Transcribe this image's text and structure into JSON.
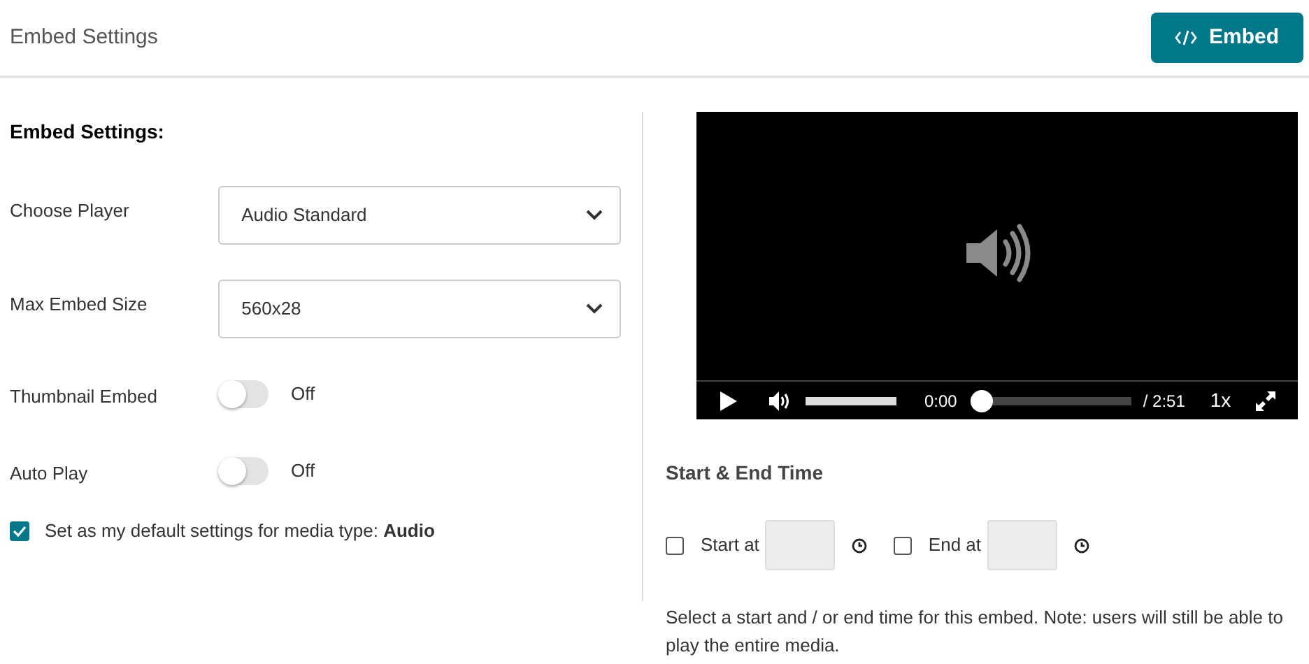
{
  "header": {
    "title": "Embed Settings",
    "embed_button": "Embed"
  },
  "settings": {
    "title": "Embed Settings:",
    "rows": [
      {
        "kind": "select",
        "label": "Choose Player",
        "value": "Audio Standard"
      },
      {
        "kind": "select",
        "label": "Max Embed Size",
        "value": "560x28"
      },
      {
        "kind": "toggle",
        "label": "Thumbnail Embed",
        "on": false,
        "state_text": "Off"
      },
      {
        "kind": "toggle",
        "label": "Auto Play",
        "on": false,
        "state_text": "Off"
      }
    ],
    "default_checkbox": {
      "label": "Set as my default settings for media type: **Audio**",
      "checked": true
    }
  },
  "player": {
    "volume": {
      "level": 1
    },
    "current_time": "0:00",
    "progress": {
      "level": 0
    },
    "duration": "/ 2:51",
    "speed": "1x"
  },
  "time_range": {
    "title": "Start & End Time",
    "items": [
      {
        "label": "Start at",
        "checked": false
      },
      {
        "label": "End at",
        "checked": false
      }
    ],
    "note": "Select a start and / or end time for this embed. Note: users will still be able to play the entire media."
  }
}
